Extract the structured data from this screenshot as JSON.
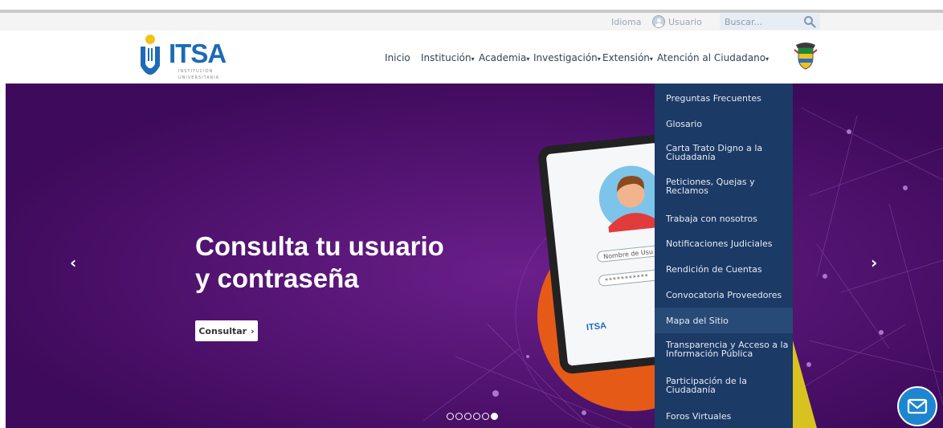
{
  "utility": {
    "language_label": "Idioma",
    "user_label": "Usuario",
    "search_placeholder": "Buscar..."
  },
  "logo": {
    "text": "ITSA",
    "subtitle_line1": "INSTITUCIÓN",
    "subtitle_line2": "UNIVERSITARIA"
  },
  "nav": {
    "items": [
      {
        "label": "Inicio",
        "has_dropdown": false
      },
      {
        "label": "Institución",
        "has_dropdown": true
      },
      {
        "label": "Academia",
        "has_dropdown": true
      },
      {
        "label": "Investigación",
        "has_dropdown": true
      },
      {
        "label": "Extensión",
        "has_dropdown": true
      },
      {
        "label": "Atención al Ciudadano",
        "has_dropdown": true
      }
    ],
    "caret": "▾"
  },
  "dropdown": {
    "items": [
      {
        "line1": "Preguntas Frecuentes",
        "line2": ""
      },
      {
        "line1": "Glosario",
        "line2": ""
      },
      {
        "line1": "Carta Trato Digno a la",
        "line2": "Ciudadanía"
      },
      {
        "line1": "Peticiones, Quejas y",
        "line2": "Reclamos"
      },
      {
        "line1": "Trabaja con nosotros",
        "line2": ""
      },
      {
        "line1": "Notificaciones Judiciales",
        "line2": ""
      },
      {
        "line1": "Rendición de Cuentas",
        "line2": ""
      },
      {
        "line1": "Convocatoria Proveedores",
        "line2": ""
      },
      {
        "line1": "Mapa del Sitio",
        "line2": ""
      },
      {
        "line1": "Transparencia y Acceso a la",
        "line2": "Información Pública"
      },
      {
        "line1": "Participación de la",
        "line2": "Ciudadanía"
      },
      {
        "line1": "Foros Virtuales",
        "line2": ""
      }
    ],
    "highlighted_index": 8
  },
  "hero": {
    "title_line1": "Consulta tu usuario",
    "title_line2": "y contraseña",
    "button_label": "Consultar",
    "button_icon": "›",
    "tablet_field_username": "Nombre de Usu",
    "tablet_field_password": "***********",
    "tablet_logo": "ITSA",
    "slide_count": 6,
    "active_slide": 6
  },
  "icons": {
    "prev": "‹",
    "next": "›",
    "user": "user-circle-icon",
    "search": "search-icon",
    "chat": "mail-icon",
    "coat": "colombia-coat-of-arms"
  },
  "colors": {
    "hero_bg": "#4a1068",
    "dropdown_bg": "#1c3a66",
    "brand_blue": "#1c6bb5",
    "chat_blue": "#1e86d0"
  }
}
